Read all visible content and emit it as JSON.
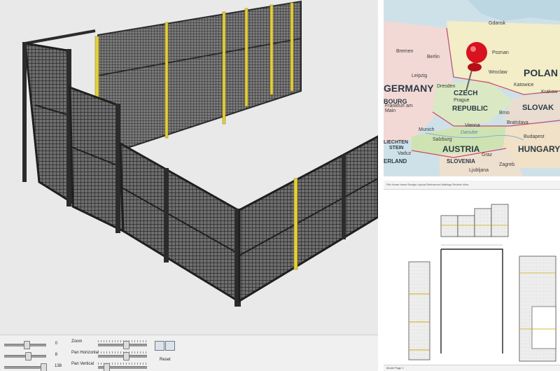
{
  "viewer": {
    "controls": [
      {
        "name": "Zoom",
        "value": "0"
      },
      {
        "name": "Pan Horizontal",
        "value": "8"
      },
      {
        "name": "Pan Vertical",
        "value": "138"
      }
    ],
    "reset_label": "Reset"
  },
  "map": {
    "countries": [
      "POLAN",
      "GERMANY",
      "CZECH",
      "REPUBLIC",
      "SLOVAK",
      "AUSTRIA",
      "HUNGARY",
      "SLOVENIA",
      "ERLAND",
      "LIECHTEN",
      "STEIN"
    ],
    "cities": [
      "Berlin",
      "Poznan",
      "Leipzig",
      "Dresden",
      "Wroclaw",
      "Katowice",
      "Krakow",
      "Prague",
      "Brno",
      "Frankfurt am Main",
      "Munich",
      "Vienna",
      "Bratislava",
      "Budapest",
      "Salzburg",
      "Graz",
      "Zagreb",
      "Ljubljana",
      "Vaduz",
      "Danube",
      "Bremen",
      "Gdansk",
      "BOURG"
    ],
    "pin_color": "#d8121f"
  },
  "drawing": {
    "ribbon_text": "File  Home  Insert  Design  Layout  References  Mailings  Review  View",
    "status_text": "Model  Page 1"
  },
  "colors": {
    "fence": "#2b2b2b",
    "post_yellow": "#e3cf3a",
    "viewer_bg": "#e9e9e9"
  }
}
